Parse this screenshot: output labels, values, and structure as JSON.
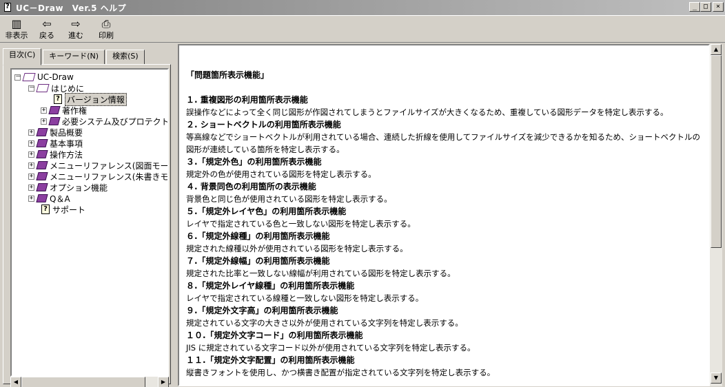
{
  "window": {
    "title": "UC－Draw　Ver.5 ヘルプ",
    "controls": [
      "_",
      "□",
      "×"
    ]
  },
  "toolbar": {
    "hide_label": "非表示",
    "back_label": "戻る",
    "forward_label": "進む",
    "print_label": "印刷"
  },
  "tabs": {
    "contents": "目次(C)",
    "keyword": "キーワード(N)",
    "search": "検索(S)"
  },
  "tree": [
    {
      "label": "UC-Draw",
      "type": "open-book",
      "expander": "－"
    },
    {
      "label": "はじめに",
      "type": "open-book",
      "expander": "－"
    },
    {
      "label": "バージョン情報",
      "type": "page",
      "expander": ""
    },
    {
      "label": "著作権",
      "type": "book",
      "expander": "+"
    },
    {
      "label": "必要システム及びプロテクト",
      "type": "book",
      "expander": "+"
    },
    {
      "label": "製品概要",
      "type": "book",
      "expander": "+"
    },
    {
      "label": "基本事項",
      "type": "book",
      "expander": "+"
    },
    {
      "label": "操作方法",
      "type": "book",
      "expander": "+"
    },
    {
      "label": "メニューリファレンス(図面モード)",
      "type": "book",
      "expander": "+"
    },
    {
      "label": "メニューリファレンス(朱書きモー",
      "type": "book",
      "expander": "+"
    },
    {
      "label": "オプション機能",
      "type": "book",
      "expander": "+"
    },
    {
      "label": "Q＆A",
      "type": "book",
      "expander": "+"
    },
    {
      "label": "サポート",
      "type": "page",
      "expander": ""
    }
  ],
  "content": {
    "heading": "「問題箇所表示機能」",
    "sections": [
      {
        "title": "１. 重複図形の利用箇所表示機能",
        "body": "誤操作などによって全く同じ図形が作図されてしまうとファイルサイズが大きくなるため、重複している図形データを特定し表示する。"
      },
      {
        "title": "２. ショートベクトルの利用箇所表示機能",
        "body": "等高線などでショートベクトルが利用されている場合、連続した折線を使用してファイルサイズを減少できるかを知るため、ショートベクトルの",
        "body2": "図形が連続している箇所を特定し表示する。"
      },
      {
        "title": "３.「規定外色」の利用箇所表示機能",
        "body": "規定外の色が使用されている図形を特定し表示する。"
      },
      {
        "title": "４. 背景同色の利用箇所の表示機能",
        "body": "背景色と同じ色が使用されている図形を特定し表示する。"
      },
      {
        "title": "５.「規定外レイヤ色」の利用箇所表示機能",
        "body": "レイヤで指定されている色と一致しない図形を特定し表示する。"
      },
      {
        "title": "６.「規定外線種」の利用箇所表示機能",
        "body": "規定された線種以外が使用されている図形を特定し表示する。"
      },
      {
        "title": "７.「規定外線幅」の利用箇所表示機能",
        "body": "規定された比率と一致しない線幅が利用されている図形を特定し表示する。"
      },
      {
        "title": "８.「規定外レイヤ線種」の利用箇所表示機能",
        "body": "レイヤで指定されている線種と一致しない図形を特定し表示する。"
      },
      {
        "title": "９.「規定外文字高」の利用箇所表示機能",
        "body": "規定されている文字の大きさ以外が使用されている文字列を特定し表示する。"
      },
      {
        "title": "１０.「規定外文字コード」の利用箇所表示機能",
        "body": "JIS に規定されている文字コード以外が使用されている文字列を特定し表示する。"
      },
      {
        "title": "１１.「規定外文字配置」の利用箇所表示機能",
        "body": "縦書きフォントを使用し、かつ横書き配置が指定されている文字列を特定し表示する。"
      }
    ]
  }
}
